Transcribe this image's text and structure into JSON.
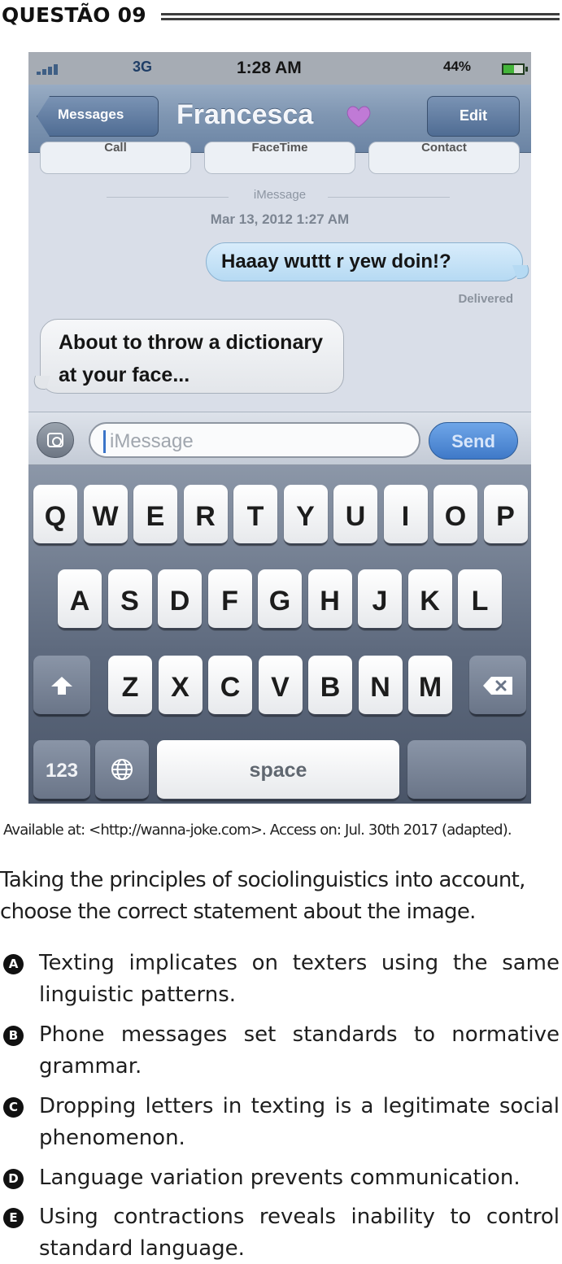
{
  "question": {
    "title": "QUESTÃO 09"
  },
  "phone": {
    "status": {
      "network": "3G",
      "time": "1:28 AM",
      "battery": "44%"
    },
    "nav": {
      "back_label": "Messages",
      "contact": "Francesca",
      "edit_label": "Edit"
    },
    "hidden_actions": [
      "Call",
      "FaceTime",
      "Contact"
    ],
    "thread": {
      "service_label": "iMessage",
      "timestamp": "Mar 13, 2012 1:27 AM",
      "sent_message": "Haaay  wuttt r yew doin!?",
      "delivered_label": "Delivered",
      "received_message": "About to throw a dictionary at your face..."
    },
    "composer": {
      "placeholder": "iMessage",
      "send_label": "Send"
    },
    "keyboard": {
      "row1": [
        "Q",
        "W",
        "E",
        "R",
        "T",
        "Y",
        "U",
        "I",
        "O",
        "P"
      ],
      "row2": [
        "A",
        "S",
        "D",
        "F",
        "G",
        "H",
        "J",
        "K",
        "L"
      ],
      "row3": [
        "Z",
        "X",
        "C",
        "V",
        "B",
        "N",
        "M"
      ],
      "numbers_label": "123",
      "space_label": "space"
    },
    "colors": {
      "send": "#3f79c8",
      "sent_bubble": "#b6daf3",
      "nav_bar": "#7f96b2"
    }
  },
  "caption": "Available at: <http://wanna-joke.com>. Access on: Jul. 30th 2017 (adapted).",
  "prompt": "Taking the principles of sociolinguistics into account, choose the correct statement about the image.",
  "options": [
    {
      "letter": "A",
      "text": "Texting implicates on texters using the same linguistic patterns."
    },
    {
      "letter": "B",
      "text": "Phone messages set standards to normative grammar."
    },
    {
      "letter": "C",
      "text": "Dropping letters in texting is a legitimate social phenomenon."
    },
    {
      "letter": "D",
      "text": "Language variation prevents communication."
    },
    {
      "letter": "E",
      "text": "Using contractions reveals inability to control standard language."
    }
  ]
}
